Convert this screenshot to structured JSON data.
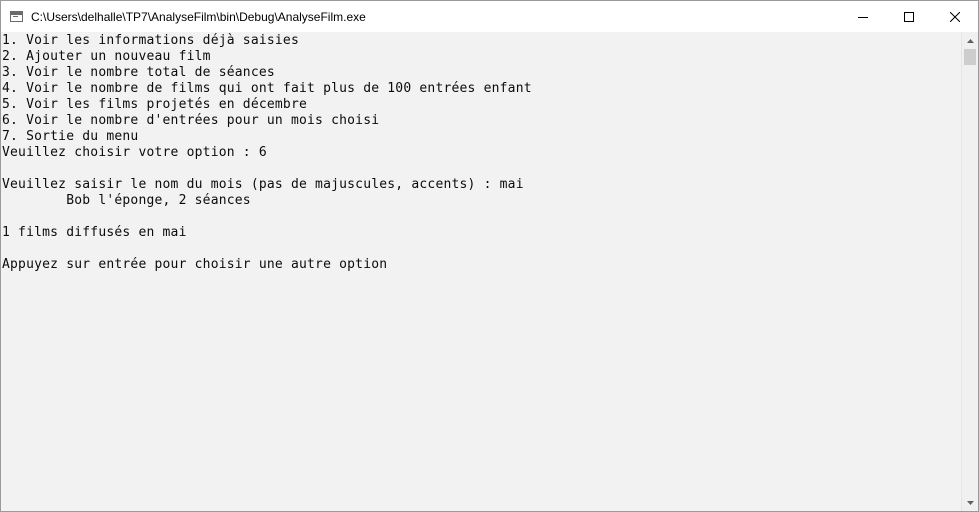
{
  "window": {
    "title": "C:\\Users\\delhalle\\TP7\\AnalyseFilm\\bin\\Debug\\AnalyseFilm.exe",
    "icon": "console-app-icon",
    "controls": [
      "minimize-icon",
      "maximize-icon",
      "close-icon"
    ]
  },
  "console": {
    "lines": [
      "1. Voir les informations déjà saisies",
      "2. Ajouter un nouveau film",
      "3. Voir le nombre total de séances",
      "4. Voir le nombre de films qui ont fait plus de 100 entrées enfant",
      "5. Voir les films projetés en décembre",
      "6. Voir le nombre d'entrées pour un mois choisi",
      "7. Sortie du menu",
      "Veuillez choisir votre option : 6",
      "",
      "Veuillez saisir le nom du mois (pas de majuscules, accents) : mai",
      "        Bob l'éponge, 2 séances",
      "",
      "1 films diffusés en mai",
      "",
      "Appuyez sur entrée pour choisir une autre option"
    ]
  },
  "colors": {
    "console_background": "#f2f2f2",
    "console_text": "#0c0c0c",
    "titlebar_background": "#ffffff"
  }
}
